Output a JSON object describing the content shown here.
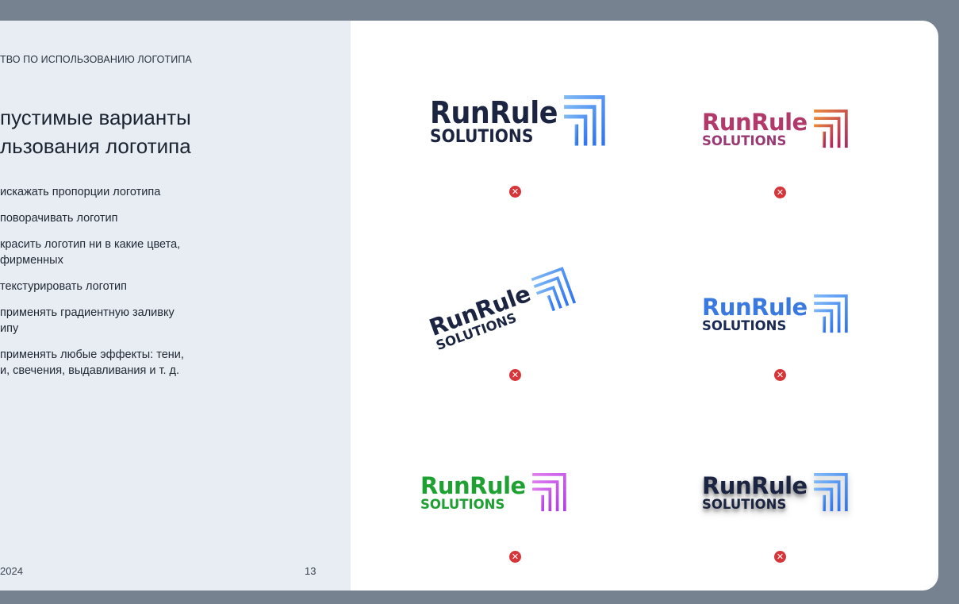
{
  "header": {
    "breadcrumb": "ТВО ПО ИСПОЛЬЗОВАНИЮ ЛОГОТИПА",
    "title_line1": "пустимые варианты",
    "title_line2": "льзования логотипа"
  },
  "rules": [
    {
      "line1": "искажать пропорции логотипа",
      "line2": ""
    },
    {
      "line1": "поворачивать логотип",
      "line2": ""
    },
    {
      "line1": "красить логотип ни в какие цвета,",
      "line2": "фирменных"
    },
    {
      "line1": "текстурировать логотип",
      "line2": ""
    },
    {
      "line1": "применять градиентную заливку",
      "line2": "ипу"
    },
    {
      "line1": "применять любые эффекты: тени,",
      "line2": "и, свечения, выдавливания и т. д."
    }
  ],
  "footer": {
    "year": "2024",
    "page_number": "13"
  },
  "logo_examples": [
    {
      "word_top": "RunRule",
      "word_bottom": "SOLUTIONS",
      "variant": "stretched",
      "text_color": "#1b2440",
      "mark_colors": [
        "#7fb9f5",
        "#2f74f0"
      ],
      "status_icon": "cross-icon"
    },
    {
      "word_top": "RunRule",
      "word_bottom": "SOLUTIONS",
      "variant": "textured",
      "text_color": "#a8355c",
      "mark_colors": [
        "#e8893a",
        "#b0245e"
      ],
      "status_icon": "cross-icon"
    },
    {
      "word_top": "RunRule",
      "word_bottom": "SOLUTIONS",
      "variant": "rotated",
      "text_color": "#1b2440",
      "mark_colors": [
        "#7fb9f5",
        "#2f74f0"
      ],
      "status_icon": "cross-icon"
    },
    {
      "word_top": "RunRule",
      "word_bottom": "SOLUTIONS",
      "variant": "gradient",
      "text_color": "#2f6fd8",
      "mark_colors": [
        "#7fb9f5",
        "#2f74f0"
      ],
      "status_icon": "cross-icon"
    },
    {
      "word_top": "RunRule",
      "word_bottom": "SOLUTIONS",
      "variant": "recolored",
      "text_color": "#22a238",
      "mark_colors": [
        "#e07ef0",
        "#b23fe0"
      ],
      "status_icon": "cross-icon"
    },
    {
      "word_top": "RunRule",
      "word_bottom": "SOLUTIONS",
      "variant": "shadowed",
      "text_color": "#1b2440",
      "mark_colors": [
        "#7fb9f5",
        "#2f74f0"
      ],
      "status_icon": "cross-icon"
    }
  ],
  "colors": {
    "accent_cross": "#d6363a",
    "panel_bg": "#e8edf4",
    "frame_bg": "#778291"
  }
}
